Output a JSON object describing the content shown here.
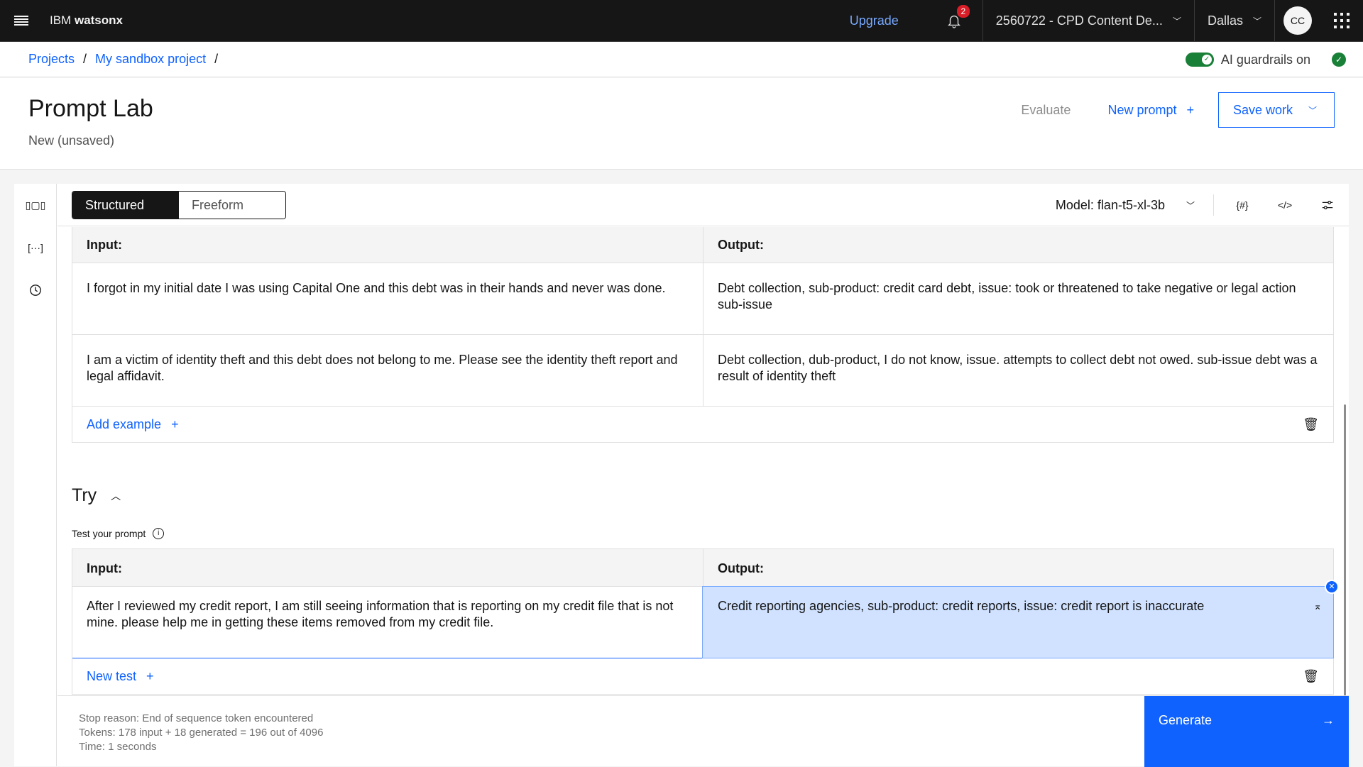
{
  "topbar": {
    "brand_prefix": "IBM",
    "brand_name": "watsonx",
    "upgrade": "Upgrade",
    "notifications_count": "2",
    "account": "2560722 - CPD Content De...",
    "region": "Dallas",
    "avatar_initials": "CC"
  },
  "breadcrumb": {
    "items": [
      "Projects",
      "My sandbox project"
    ],
    "separator": "/"
  },
  "guardrails": {
    "label": "AI guardrails on",
    "enabled": true,
    "status_color": "#198038"
  },
  "header": {
    "title": "Prompt Lab",
    "subtitle": "New (unsaved)",
    "evaluate": "Evaluate",
    "new_prompt": "New prompt",
    "save_work": "Save work"
  },
  "toolbar": {
    "modes": [
      "Structured",
      "Freeform"
    ],
    "active_mode": "Structured",
    "model_label": "Model: flan-t5-xl-3b",
    "icons": [
      "variables-icon",
      "code-icon",
      "settings-sliders-icon"
    ]
  },
  "rail": {
    "icons": [
      "sample-prompts-icon",
      "saved-prompts-icon",
      "history-icon"
    ]
  },
  "examples": {
    "input_header": "Input:",
    "output_header": "Output:",
    "rows": [
      {
        "input": "I forgot in my initial date I was using Capital One and this debt was in their hands and never was done.",
        "output": "Debt collection, sub-product: credit card debt, issue: took or threatened to take negative or legal action sub-issue"
      },
      {
        "input": "I am a victim of identity theft and this debt does not belong to me. Please see the identity theft report and legal affidavit.",
        "output": "Debt collection, dub-product, I do not know, issue. attempts to collect debt not owed. sub-issue debt was a result of identity theft"
      }
    ],
    "add_example": "Add example"
  },
  "try": {
    "title": "Try",
    "test_label": "Test your prompt",
    "input_header": "Input:",
    "output_header": "Output:",
    "test_input": "After I reviewed my credit report, I am still seeing information that is reporting on my credit file that is not mine. please help me in getting these items removed from my credit file.",
    "test_output": "Credit reporting agencies, sub-product: credit reports, issue: credit report is inaccurate",
    "new_test": "New test"
  },
  "footer": {
    "stop_reason": "Stop reason: End of sequence token encountered",
    "tokens": "Tokens: 178 input + 18 generated = 196 out of 4096",
    "time": "Time: 1 seconds",
    "generate": "Generate"
  },
  "colors": {
    "accent": "#0f62fe",
    "topbar_bg": "#161616",
    "badge": "#da1e28",
    "selected_output_bg": "#d0e2ff"
  }
}
